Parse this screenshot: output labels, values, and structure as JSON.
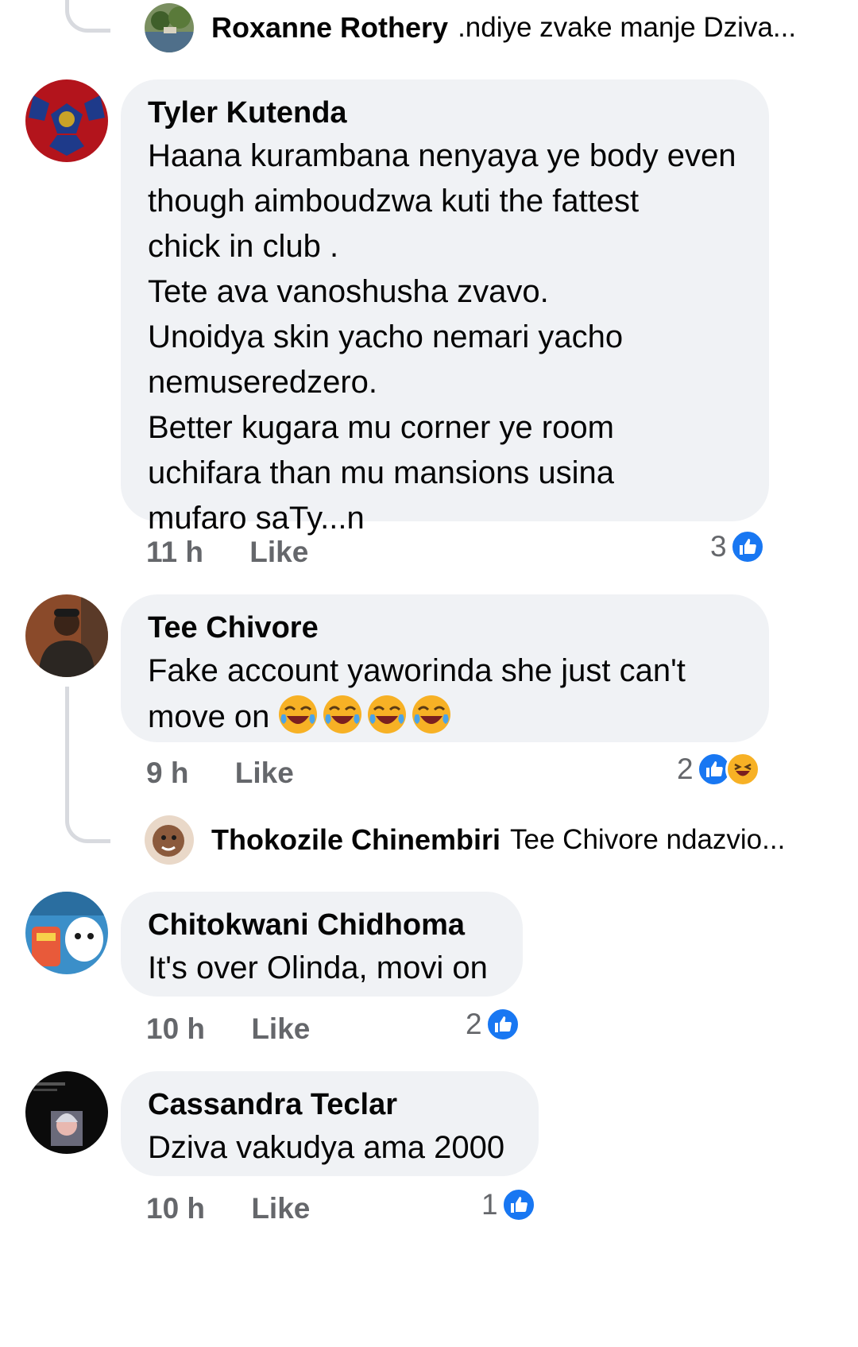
{
  "comments": [
    {
      "author": "Tyler Kutenda",
      "text": "Haana kurambana nenyaya ye body even\nthough aimboudzwa kuti the fattest\nchick in club .\nTete ava vanoshusha zvavo.\nUnoidya skin yacho nemari yacho\nnemuseredzero.\nBetter kugara mu corner ye room\nuchifara than mu mansions usina\nmufaro saTy...n",
      "time": "11 h",
      "like_label": "Like",
      "reaction_count": "3",
      "reactions": [
        "like-icon"
      ]
    },
    {
      "author": "Tee Chivore",
      "text": "Fake account yaworinda she just can't\nmove on",
      "emojis": [
        "laugh-cry-emoji",
        "laugh-cry-emoji",
        "laugh-cry-emoji",
        "laugh-cry-emoji"
      ],
      "time": "9 h",
      "like_label": "Like",
      "reaction_count": "2",
      "reactions": [
        "like-icon",
        "haha-icon"
      ]
    },
    {
      "author": "Chitokwani Chidhoma",
      "text": "It's over Olinda, movi on",
      "time": "10 h",
      "like_label": "Like",
      "reaction_count": "2",
      "reactions": [
        "like-icon"
      ]
    },
    {
      "author": "Cassandra Teclar",
      "text": "Dziva vakudya ama 2000",
      "time": "10 h",
      "like_label": "Like",
      "reaction_count": "1",
      "reactions": [
        "like-icon"
      ]
    }
  ],
  "replies": [
    {
      "author": "Roxanne Rothery",
      "preview": ".ndiye zvake manje Dziva..."
    },
    {
      "author": "Thokozile Chinembiri",
      "preview": "Tee Chivore ndazvio..."
    }
  ],
  "colors": {
    "bubble": "#f0f2f5",
    "like_blue": "#1877f2",
    "meta_gray": "#65676b",
    "haha_yellow": "#f7b125"
  }
}
